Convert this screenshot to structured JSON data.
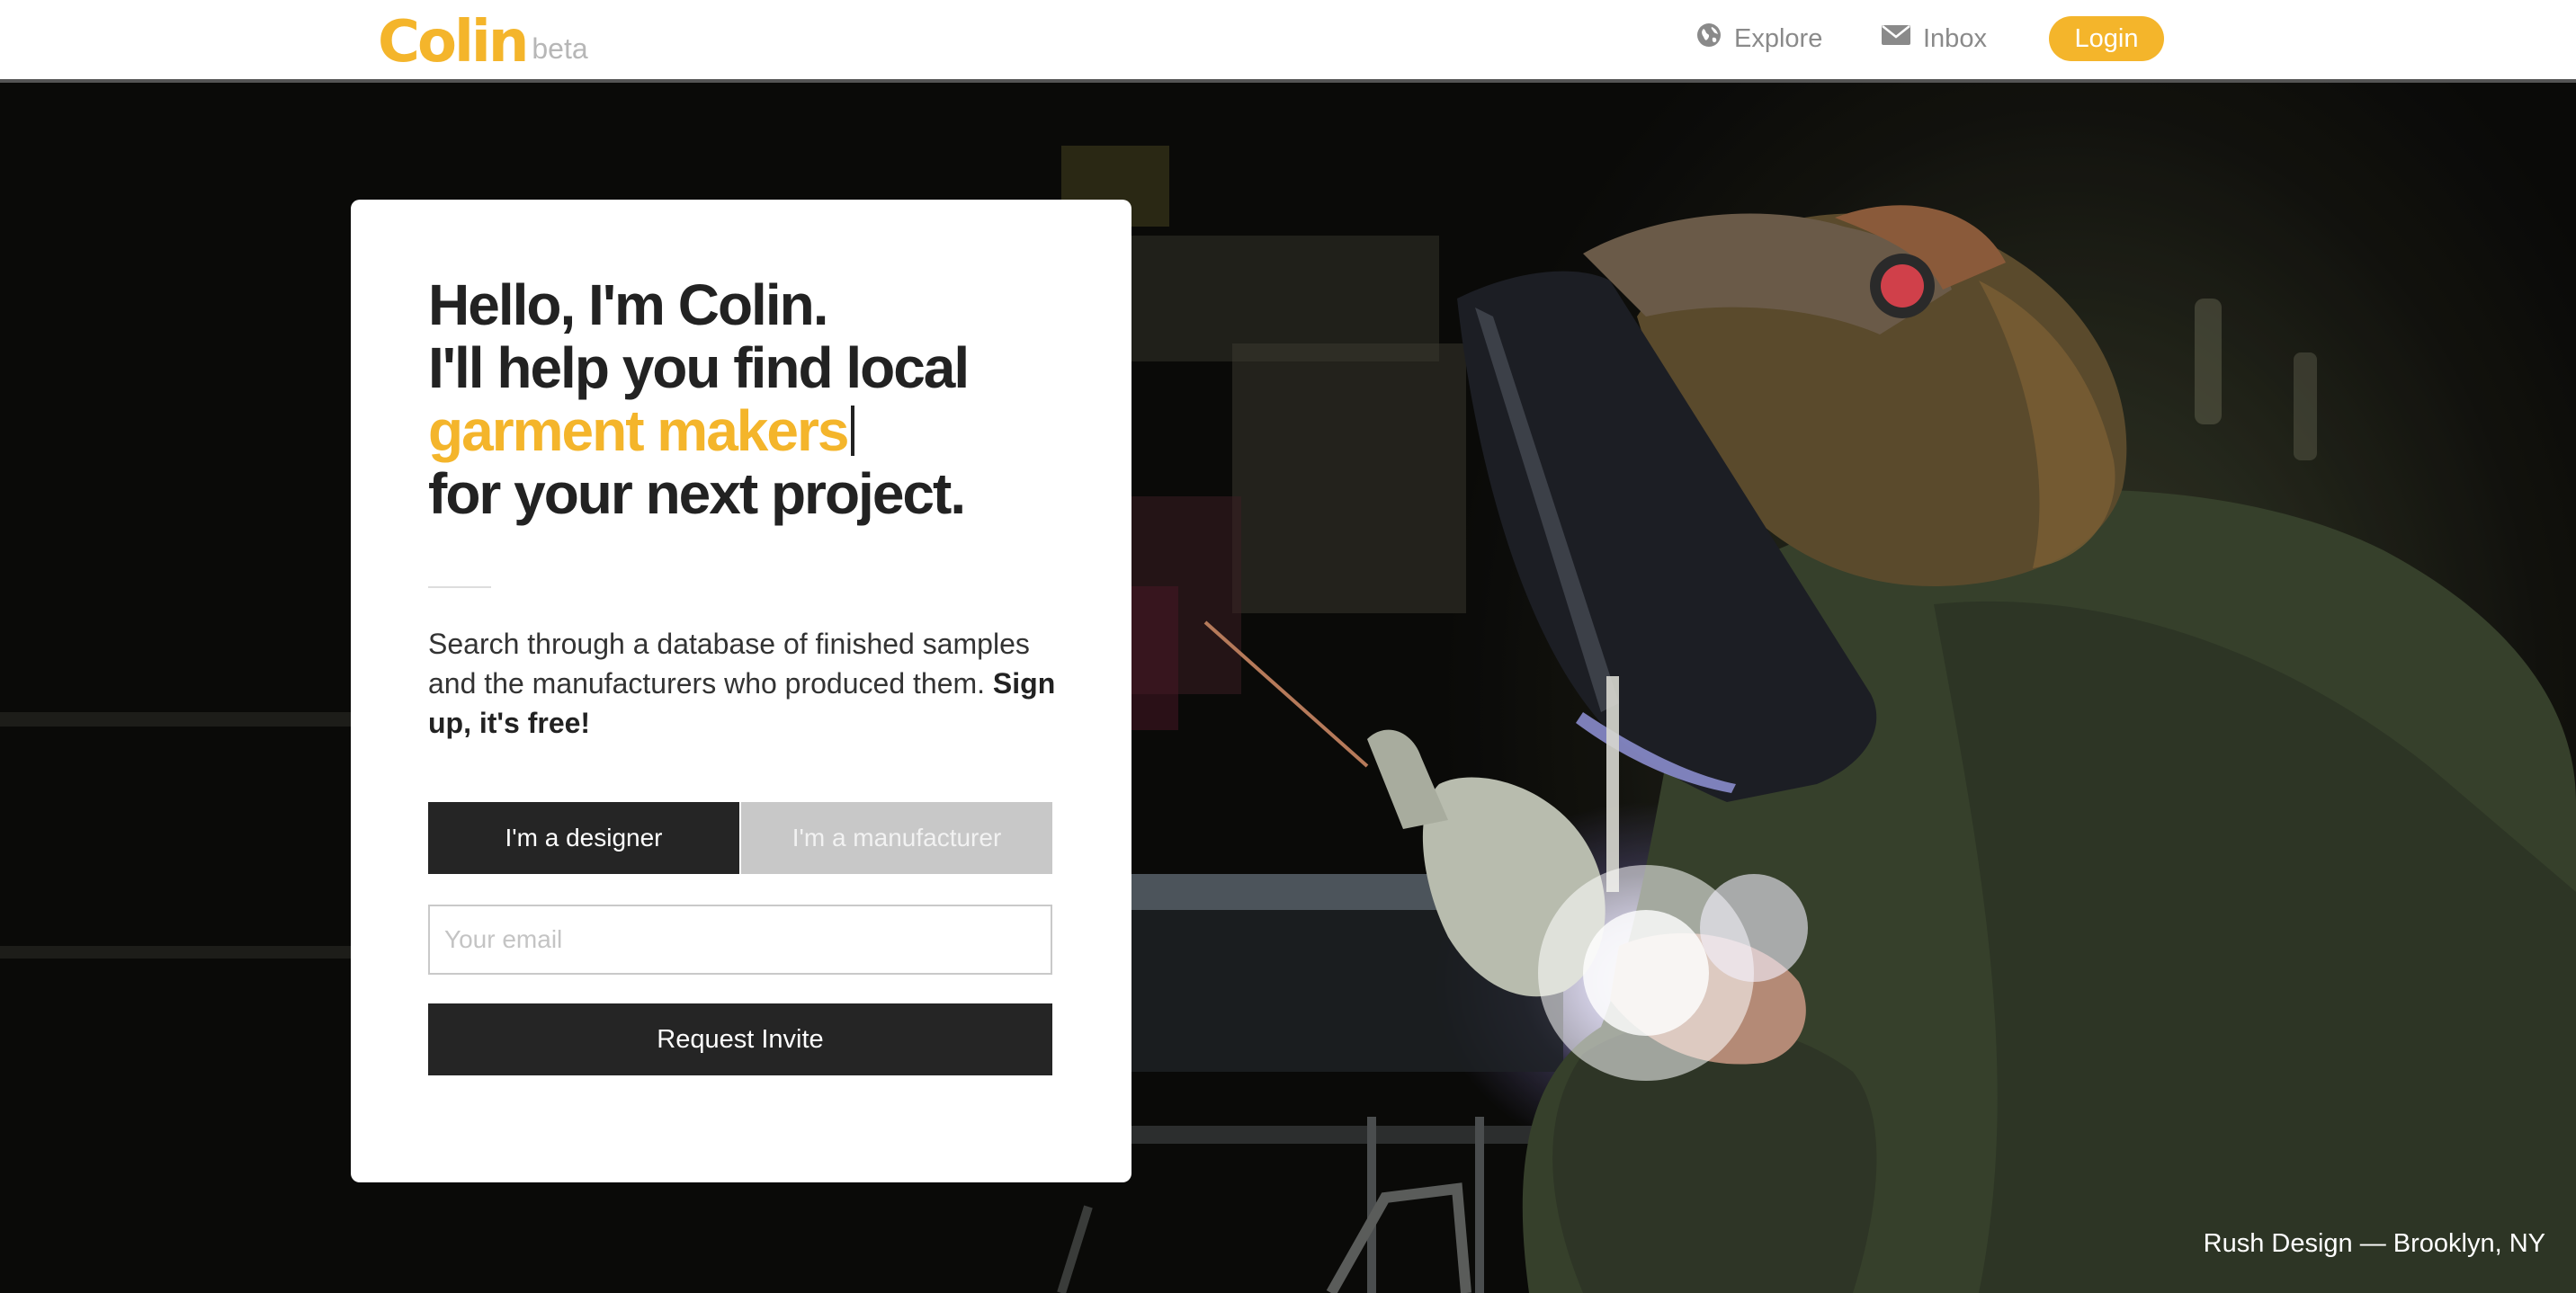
{
  "nav": {
    "logo": "Colin",
    "logo_tag": "beta",
    "explore": "Explore",
    "inbox": "Inbox",
    "login": "Login"
  },
  "hero": {
    "line1": "Hello, I'm Colin.",
    "line2": "I'll help you find local",
    "highlight": "garment makers",
    "line4": "for your next project.",
    "description": "Search through a database of finished samples and the manufacturers who produced them.",
    "description_bold": "Sign up, it's free!",
    "toggle_designer": "I'm a designer",
    "toggle_manufacturer": "I'm a manufacturer",
    "email_placeholder": "Your email",
    "request_button": "Request Invite",
    "photo_caption": "Rush Design — Brooklyn, NY"
  },
  "colors": {
    "accent": "#f4b52b",
    "dark": "#252525",
    "inactive": "#c8c8c8"
  },
  "icons": {
    "explore": "globe-icon",
    "inbox": "envelope-icon"
  }
}
